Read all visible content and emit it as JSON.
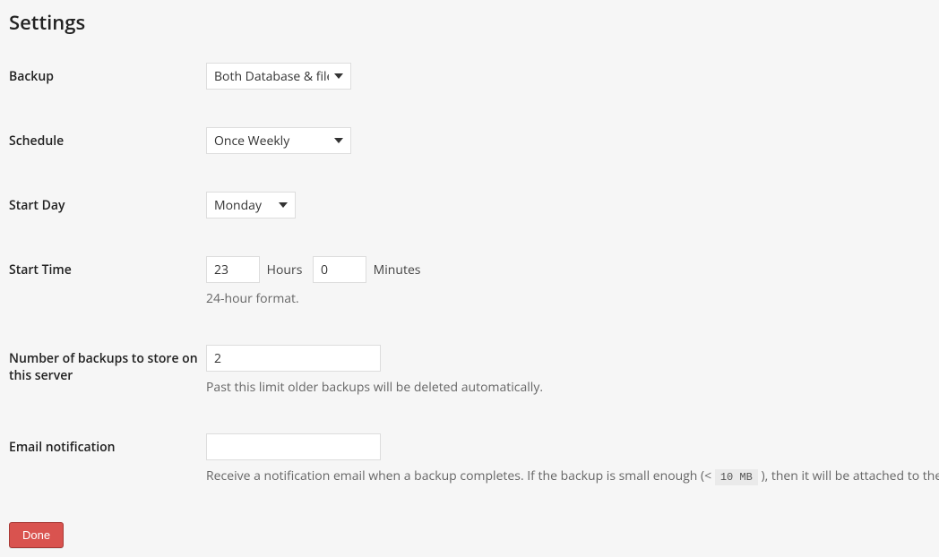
{
  "page_title": "Settings",
  "fields": {
    "backup": {
      "label": "Backup",
      "value": "Both Database & files"
    },
    "schedule": {
      "label": "Schedule",
      "value": "Once Weekly"
    },
    "start_day": {
      "label": "Start Day",
      "value": "Monday"
    },
    "start_time": {
      "label": "Start Time",
      "hours": "23",
      "hours_label": "Hours",
      "minutes": "0",
      "minutes_label": "Minutes",
      "hint": "24-hour format."
    },
    "num_backups": {
      "label": "Number of backups to store on this server",
      "value": "2",
      "hint": "Past this limit older backups will be deleted automatically."
    },
    "email": {
      "label": "Email notification",
      "value": "",
      "hint_pre": "Receive a notification email when a backup completes. If the backup is small enough (< ",
      "hint_code": "10 MB",
      "hint_post": " ), then it will be attached to the email. S"
    }
  },
  "buttons": {
    "done": "Done"
  }
}
